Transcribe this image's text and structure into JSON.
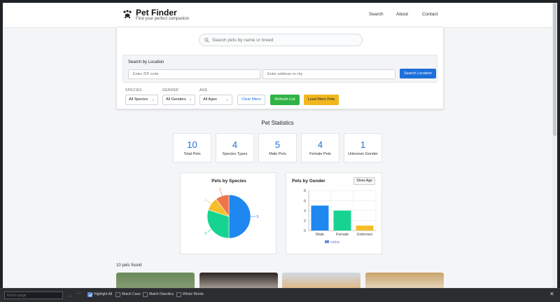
{
  "header": {
    "title": "Pet Finder",
    "subtitle": "Find your perfect companion",
    "nav": [
      "Search",
      "About",
      "Contact"
    ]
  },
  "search": {
    "placeholder": "Search pets by name or breed",
    "value": ""
  },
  "location": {
    "title": "Search by Location",
    "zip_placeholder": "Enter ZIP code",
    "address_placeholder": "Enter address or city",
    "button": "Search Location"
  },
  "filters": {
    "species": {
      "label": "SPECIES",
      "value": "All Species"
    },
    "gender": {
      "label": "GENDER",
      "value": "All Genders"
    },
    "age": {
      "label": "AGE",
      "value": "All Ages"
    },
    "clear": "Clear filters",
    "refresh": "Refresh List",
    "load_more": "Load More Pets"
  },
  "stats": {
    "title": "Pet Statistics",
    "cards": [
      {
        "value": "10",
        "label": "Total Pets"
      },
      {
        "value": "4",
        "label": "Species Types"
      },
      {
        "value": "5",
        "label": "Male Pets"
      },
      {
        "value": "4",
        "label": "Female Pets"
      },
      {
        "value": "1",
        "label": "Unknown Gender"
      }
    ]
  },
  "charts": {
    "species_title": "Pets by Species",
    "gender_title": "Pets by Gender",
    "show_age": "Show Age"
  },
  "chart_data": [
    {
      "type": "pie",
      "title": "Pets by Species",
      "labels": [
        "",
        "",
        "",
        ""
      ],
      "values": [
        5,
        3,
        1,
        1
      ],
      "colors": [
        "#1e88f0",
        "#16d48f",
        "#f7be2c",
        "#f0744a"
      ],
      "data_labels": [
        "5",
        "3",
        "1",
        "1"
      ]
    },
    {
      "type": "bar",
      "title": "Pets by Gender",
      "categories": [
        "Male",
        "Female",
        "Unknown"
      ],
      "values": [
        5,
        4,
        1
      ],
      "colors": [
        "#1e88f0",
        "#16d48f",
        "#f7be2c"
      ],
      "ylim": [
        0,
        8
      ],
      "yticks": [
        "0",
        "2",
        "4",
        "6",
        "8"
      ],
      "legend": "value",
      "grid": true
    }
  ],
  "results": {
    "count_text": "10 pets found"
  },
  "findbar": {
    "placeholder": "Find in page",
    "options": [
      {
        "label": "Highlight All",
        "checked": true
      },
      {
        "label": "Match Case",
        "checked": false
      },
      {
        "label": "Match Diacritics",
        "checked": false
      },
      {
        "label": "Whole Words",
        "checked": false
      }
    ]
  }
}
